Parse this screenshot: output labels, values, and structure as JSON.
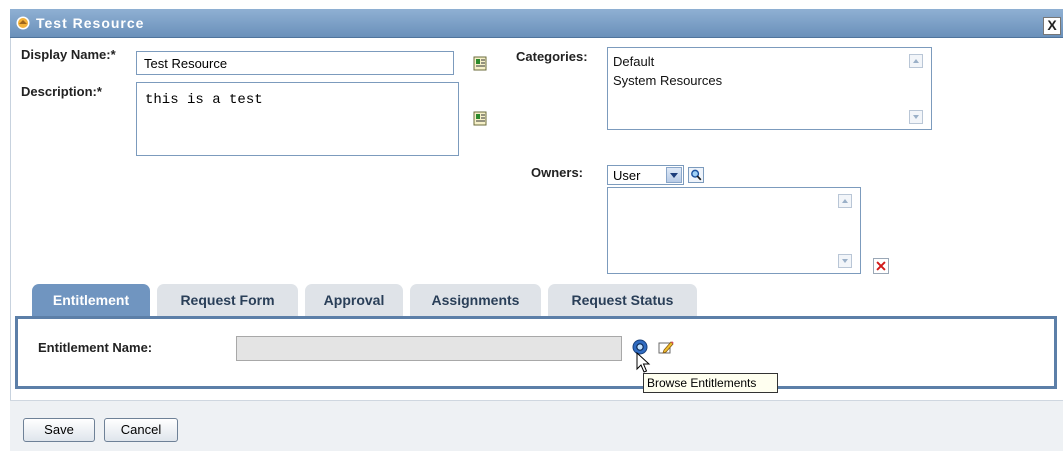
{
  "window": {
    "title": "Test Resource",
    "close_glyph": "X",
    "title_icon": "resource-icon"
  },
  "form": {
    "display_name_label": "Display Name:*",
    "display_name_value": "Test Resource",
    "description_label": "Description:*",
    "description_value": "this is a test",
    "categories_label": "Categories:",
    "categories": [
      "Default",
      "System Resources"
    ],
    "owners_label": "Owners:",
    "owners_type_selected": "User",
    "owners_list": []
  },
  "tabs": [
    {
      "label": "Entitlement",
      "active": true
    },
    {
      "label": "Request Form",
      "active": false
    },
    {
      "label": "Approval",
      "active": false
    },
    {
      "label": "Assignments",
      "active": false
    },
    {
      "label": "Request Status",
      "active": false
    }
  ],
  "entitlement": {
    "name_label": "Entitlement Name:",
    "name_value": "",
    "tooltip": "Browse Entitlements"
  },
  "footer": {
    "save_label": "Save",
    "cancel_label": "Cancel"
  },
  "colors": {
    "titlebar": "#7b9fc7",
    "active_tab": "#7095c0",
    "inactive_tab": "#dfe3e8",
    "panel_border": "#5c7fa8",
    "delete_red": "#d11a1a"
  }
}
